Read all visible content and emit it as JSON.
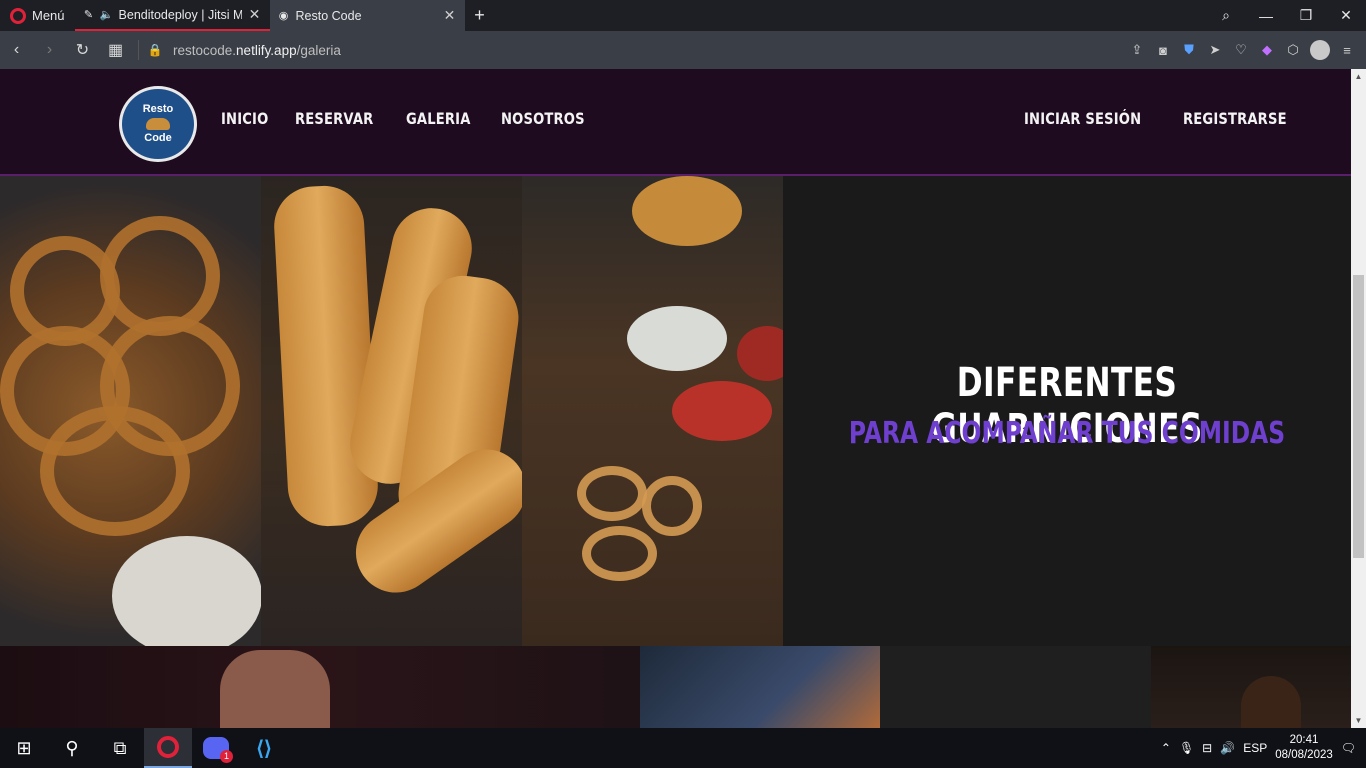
{
  "browser": {
    "menu_label": "Menú",
    "tabs": [
      {
        "title": "Benditodeploy | Jitsi Me",
        "active": false
      },
      {
        "title": "Resto Code",
        "active": true
      }
    ],
    "url_prefix": "restocode.",
    "url_domain": "netlify.app",
    "url_path": "/galeria"
  },
  "site": {
    "logo_top": "Resto",
    "logo_bottom": "Code",
    "nav": [
      "INICIO",
      "RESERVAR",
      "GALERIA",
      "NOSOTROS"
    ],
    "auth": [
      "INICIAR SESIÓN",
      "REGISTRARSE"
    ]
  },
  "gallery": {
    "caption_title": "DIFERENTES GUARNICIONES",
    "caption_subtitle": "PARA ACOMPAÑAR TUS COMIDAS"
  },
  "taskbar": {
    "language": "ESP",
    "time": "20:41",
    "date": "08/08/2023",
    "discord_badge": "1"
  },
  "colors": {
    "accent_purple": "#6f3fcf",
    "nav_bg": "#1f0b1f",
    "opera_red": "#e0213a"
  }
}
